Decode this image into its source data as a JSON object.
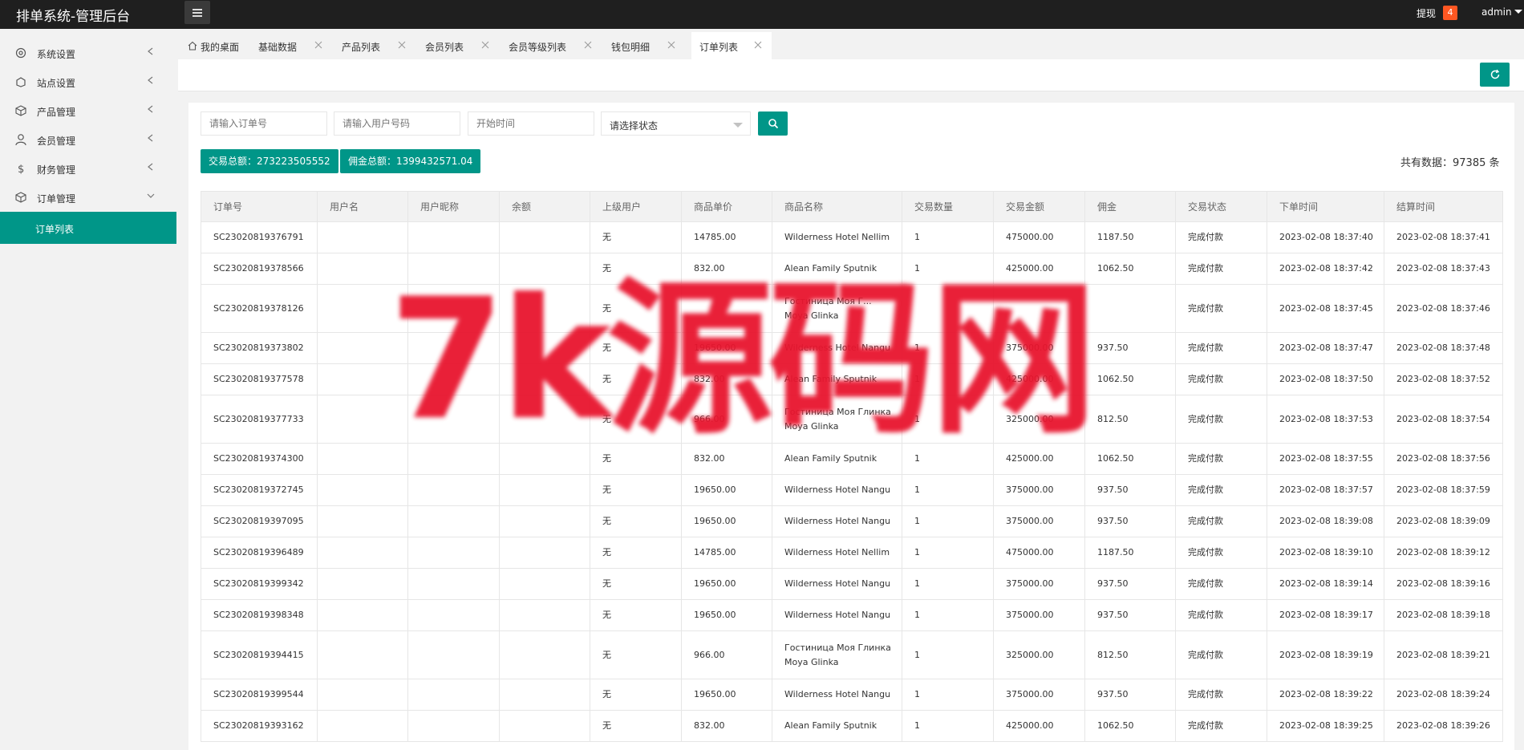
{
  "header": {
    "app_title": "排单系统-管理后台",
    "withdraw_label": "提现",
    "withdraw_count": "4",
    "user_name": "admin"
  },
  "sidebar": {
    "items": [
      {
        "label": "系统设置",
        "icon": "gear-icon"
      },
      {
        "label": "站点设置",
        "icon": "site-icon"
      },
      {
        "label": "产品管理",
        "icon": "box-icon"
      },
      {
        "label": "会员管理",
        "icon": "user-icon"
      },
      {
        "label": "财务管理",
        "icon": "dollar-icon"
      },
      {
        "label": "订单管理",
        "icon": "box-icon"
      }
    ],
    "sub_item": "订单列表"
  },
  "tabs": [
    {
      "label": "我的桌面"
    },
    {
      "label": "基础数据"
    },
    {
      "label": "产品列表"
    },
    {
      "label": "会员列表"
    },
    {
      "label": "会员等级列表"
    },
    {
      "label": "钱包明细"
    },
    {
      "label": "订单列表"
    }
  ],
  "filters": {
    "order_placeholder": "请输入订单号",
    "phone_placeholder": "请输入用户号码",
    "start_placeholder": "开始时间",
    "status_label": "请选择状态"
  },
  "summary": {
    "trade_total": "交易总额：273223505552",
    "commission_total": "佣金总额：1399432571.04",
    "record_count": "共有数据：97385 条"
  },
  "table": {
    "headers": [
      "订单号",
      "用户名",
      "用户昵称",
      "余额",
      "上级用户",
      "商品单价",
      "商品名称",
      "交易数量",
      "交易金额",
      "佣金",
      "交易状态",
      "下单时间",
      "结算时间"
    ],
    "rows": [
      {
        "id": "SC23020819376791",
        "parent": "无",
        "price": "14785.00",
        "name": "Wilderness Hotel Nellim",
        "qty": "1",
        "amount": "475000.00",
        "comm": "1187.50",
        "status": "完成付款",
        "order_time": "2023-02-08 18:37:40",
        "settle_time": "2023-02-08 18:37:41"
      },
      {
        "id": "SC23020819378566",
        "parent": "无",
        "price": "832.00",
        "name": "Alean Family Sputnik",
        "qty": "1",
        "amount": "425000.00",
        "comm": "1062.50",
        "status": "完成付款",
        "order_time": "2023-02-08 18:37:42",
        "settle_time": "2023-02-08 18:37:43"
      },
      {
        "id": "SC23020819378126",
        "parent": "无",
        "price": "",
        "name": "Гостиница Моя Г...\nMoya Glinka",
        "qty": "",
        "amount": "",
        "comm": "",
        "status": "完成付款",
        "order_time": "2023-02-08 18:37:45",
        "settle_time": "2023-02-08 18:37:46"
      },
      {
        "id": "SC23020819373802",
        "parent": "无",
        "price": "19650.00",
        "name": "Wilderness Hotel Nangu",
        "qty": "1",
        "amount": "375000.00",
        "comm": "937.50",
        "status": "完成付款",
        "order_time": "2023-02-08 18:37:47",
        "settle_time": "2023-02-08 18:37:48"
      },
      {
        "id": "SC23020819377578",
        "parent": "无",
        "price": "832.00",
        "name": "Alean Family Sputnik",
        "qty": "1",
        "amount": "425000.00",
        "comm": "1062.50",
        "status": "完成付款",
        "order_time": "2023-02-08 18:37:50",
        "settle_time": "2023-02-08 18:37:52"
      },
      {
        "id": "SC23020819377733",
        "parent": "无",
        "price": "966.00",
        "name": "Гостиница Моя Глинка\nMoya Glinka",
        "qty": "1",
        "amount": "325000.00",
        "comm": "812.50",
        "status": "完成付款",
        "order_time": "2023-02-08 18:37:53",
        "settle_time": "2023-02-08 18:37:54"
      },
      {
        "id": "SC23020819374300",
        "parent": "无",
        "price": "832.00",
        "name": "Alean Family Sputnik",
        "qty": "1",
        "amount": "425000.00",
        "comm": "1062.50",
        "status": "完成付款",
        "order_time": "2023-02-08 18:37:55",
        "settle_time": "2023-02-08 18:37:56"
      },
      {
        "id": "SC23020819372745",
        "parent": "无",
        "price": "19650.00",
        "name": "Wilderness Hotel Nangu",
        "qty": "1",
        "amount": "375000.00",
        "comm": "937.50",
        "status": "完成付款",
        "order_time": "2023-02-08 18:37:57",
        "settle_time": "2023-02-08 18:37:59"
      },
      {
        "id": "SC23020819397095",
        "parent": "无",
        "price": "19650.00",
        "name": "Wilderness Hotel Nangu",
        "qty": "1",
        "amount": "375000.00",
        "comm": "937.50",
        "status": "完成付款",
        "order_time": "2023-02-08 18:39:08",
        "settle_time": "2023-02-08 18:39:09"
      },
      {
        "id": "SC23020819396489",
        "parent": "无",
        "price": "14785.00",
        "name": "Wilderness Hotel Nellim",
        "qty": "1",
        "amount": "475000.00",
        "comm": "1187.50",
        "status": "完成付款",
        "order_time": "2023-02-08 18:39:10",
        "settle_time": "2023-02-08 18:39:12"
      },
      {
        "id": "SC23020819399342",
        "parent": "无",
        "price": "19650.00",
        "name": "Wilderness Hotel Nangu",
        "qty": "1",
        "amount": "375000.00",
        "comm": "937.50",
        "status": "完成付款",
        "order_time": "2023-02-08 18:39:14",
        "settle_time": "2023-02-08 18:39:16"
      },
      {
        "id": "SC23020819398348",
        "parent": "无",
        "price": "19650.00",
        "name": "Wilderness Hotel Nangu",
        "qty": "1",
        "amount": "375000.00",
        "comm": "937.50",
        "status": "完成付款",
        "order_time": "2023-02-08 18:39:17",
        "settle_time": "2023-02-08 18:39:18"
      },
      {
        "id": "SC23020819394415",
        "parent": "无",
        "price": "966.00",
        "name": "Гостиница Моя Глинка\nMoya Glinka",
        "qty": "1",
        "amount": "325000.00",
        "comm": "812.50",
        "status": "完成付款",
        "order_time": "2023-02-08 18:39:19",
        "settle_time": "2023-02-08 18:39:21"
      },
      {
        "id": "SC23020819399544",
        "parent": "无",
        "price": "19650.00",
        "name": "Wilderness Hotel Nangu",
        "qty": "1",
        "amount": "375000.00",
        "comm": "937.50",
        "status": "完成付款",
        "order_time": "2023-02-08 18:39:22",
        "settle_time": "2023-02-08 18:39:24"
      },
      {
        "id": "SC23020819393162",
        "parent": "无",
        "price": "832.00",
        "name": "Alean Family Sputnik",
        "qty": "1",
        "amount": "425000.00",
        "comm": "1062.50",
        "status": "完成付款",
        "order_time": "2023-02-08 18:39:25",
        "settle_time": "2023-02-08 18:39:26"
      }
    ]
  },
  "watermark": "7k源码网",
  "colors": {
    "accent": "#009688",
    "header": "#1f1f1f",
    "badge": "#ff5722",
    "watermark": "#e8152e"
  }
}
